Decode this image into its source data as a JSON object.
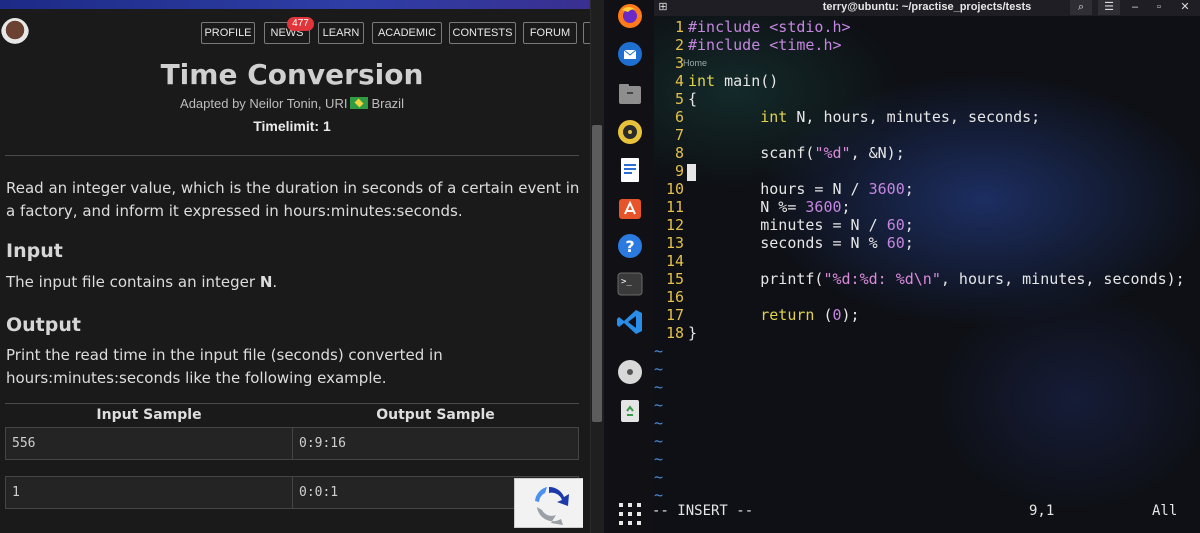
{
  "browser": {
    "nav": [
      "PROFILE",
      "NEWS",
      "LEARN",
      "ACADEMIC",
      "CONTESTS",
      "FORUM"
    ],
    "news_badge": "477",
    "problem": {
      "title": "Time Conversion",
      "adapted": "Adapted by Neilor Tonin, URI",
      "country": "Brazil",
      "timelimit": "Timelimit: 1",
      "description": "Read an integer value, which is the duration in seconds of a certain event in a factory, and inform it expressed in hours:minutes:seconds.",
      "input_heading": "Input",
      "input_text": "The input file contains an integer ",
      "input_var": "N",
      "input_end": ".",
      "output_heading": "Output",
      "output_text": "Print the read time in the input file (seconds) converted in hours:minutes:seconds like the following example.",
      "table_headers": [
        "Input Sample",
        "Output Sample"
      ],
      "rows": [
        {
          "input": "556",
          "output": "0:9:16"
        },
        {
          "input": "1",
          "output": "0:0:1"
        }
      ]
    }
  },
  "terminal": {
    "title": "terry@ubuntu: ~/practise_projects/tests",
    "home_hint": "Home",
    "line_numbers": [
      "1",
      "2",
      "3",
      "4",
      "5",
      "6",
      "7",
      "8",
      "9",
      "10",
      "11",
      "12",
      "13",
      "14",
      "15",
      "16",
      "17",
      "18"
    ],
    "status_mode": "-- INSERT --",
    "status_position": "9,1",
    "status_scroll": "All"
  },
  "colors": {
    "accent_badge": "#e0353b",
    "vim_line_number": "#e4c04a",
    "vim_keyword": "#e0d24b",
    "vim_constant": "#c586e0",
    "vim_tilde": "#4b8ad8"
  },
  "icons": {
    "dock": [
      "firefox-icon",
      "thunderbird-icon",
      "files-icon",
      "rhythmbox-icon",
      "writer-icon",
      "software-center-icon",
      "help-icon",
      "terminal-icon",
      "vscode-icon",
      "disc-icon",
      "trash-icon",
      "app-grid-icon"
    ]
  }
}
